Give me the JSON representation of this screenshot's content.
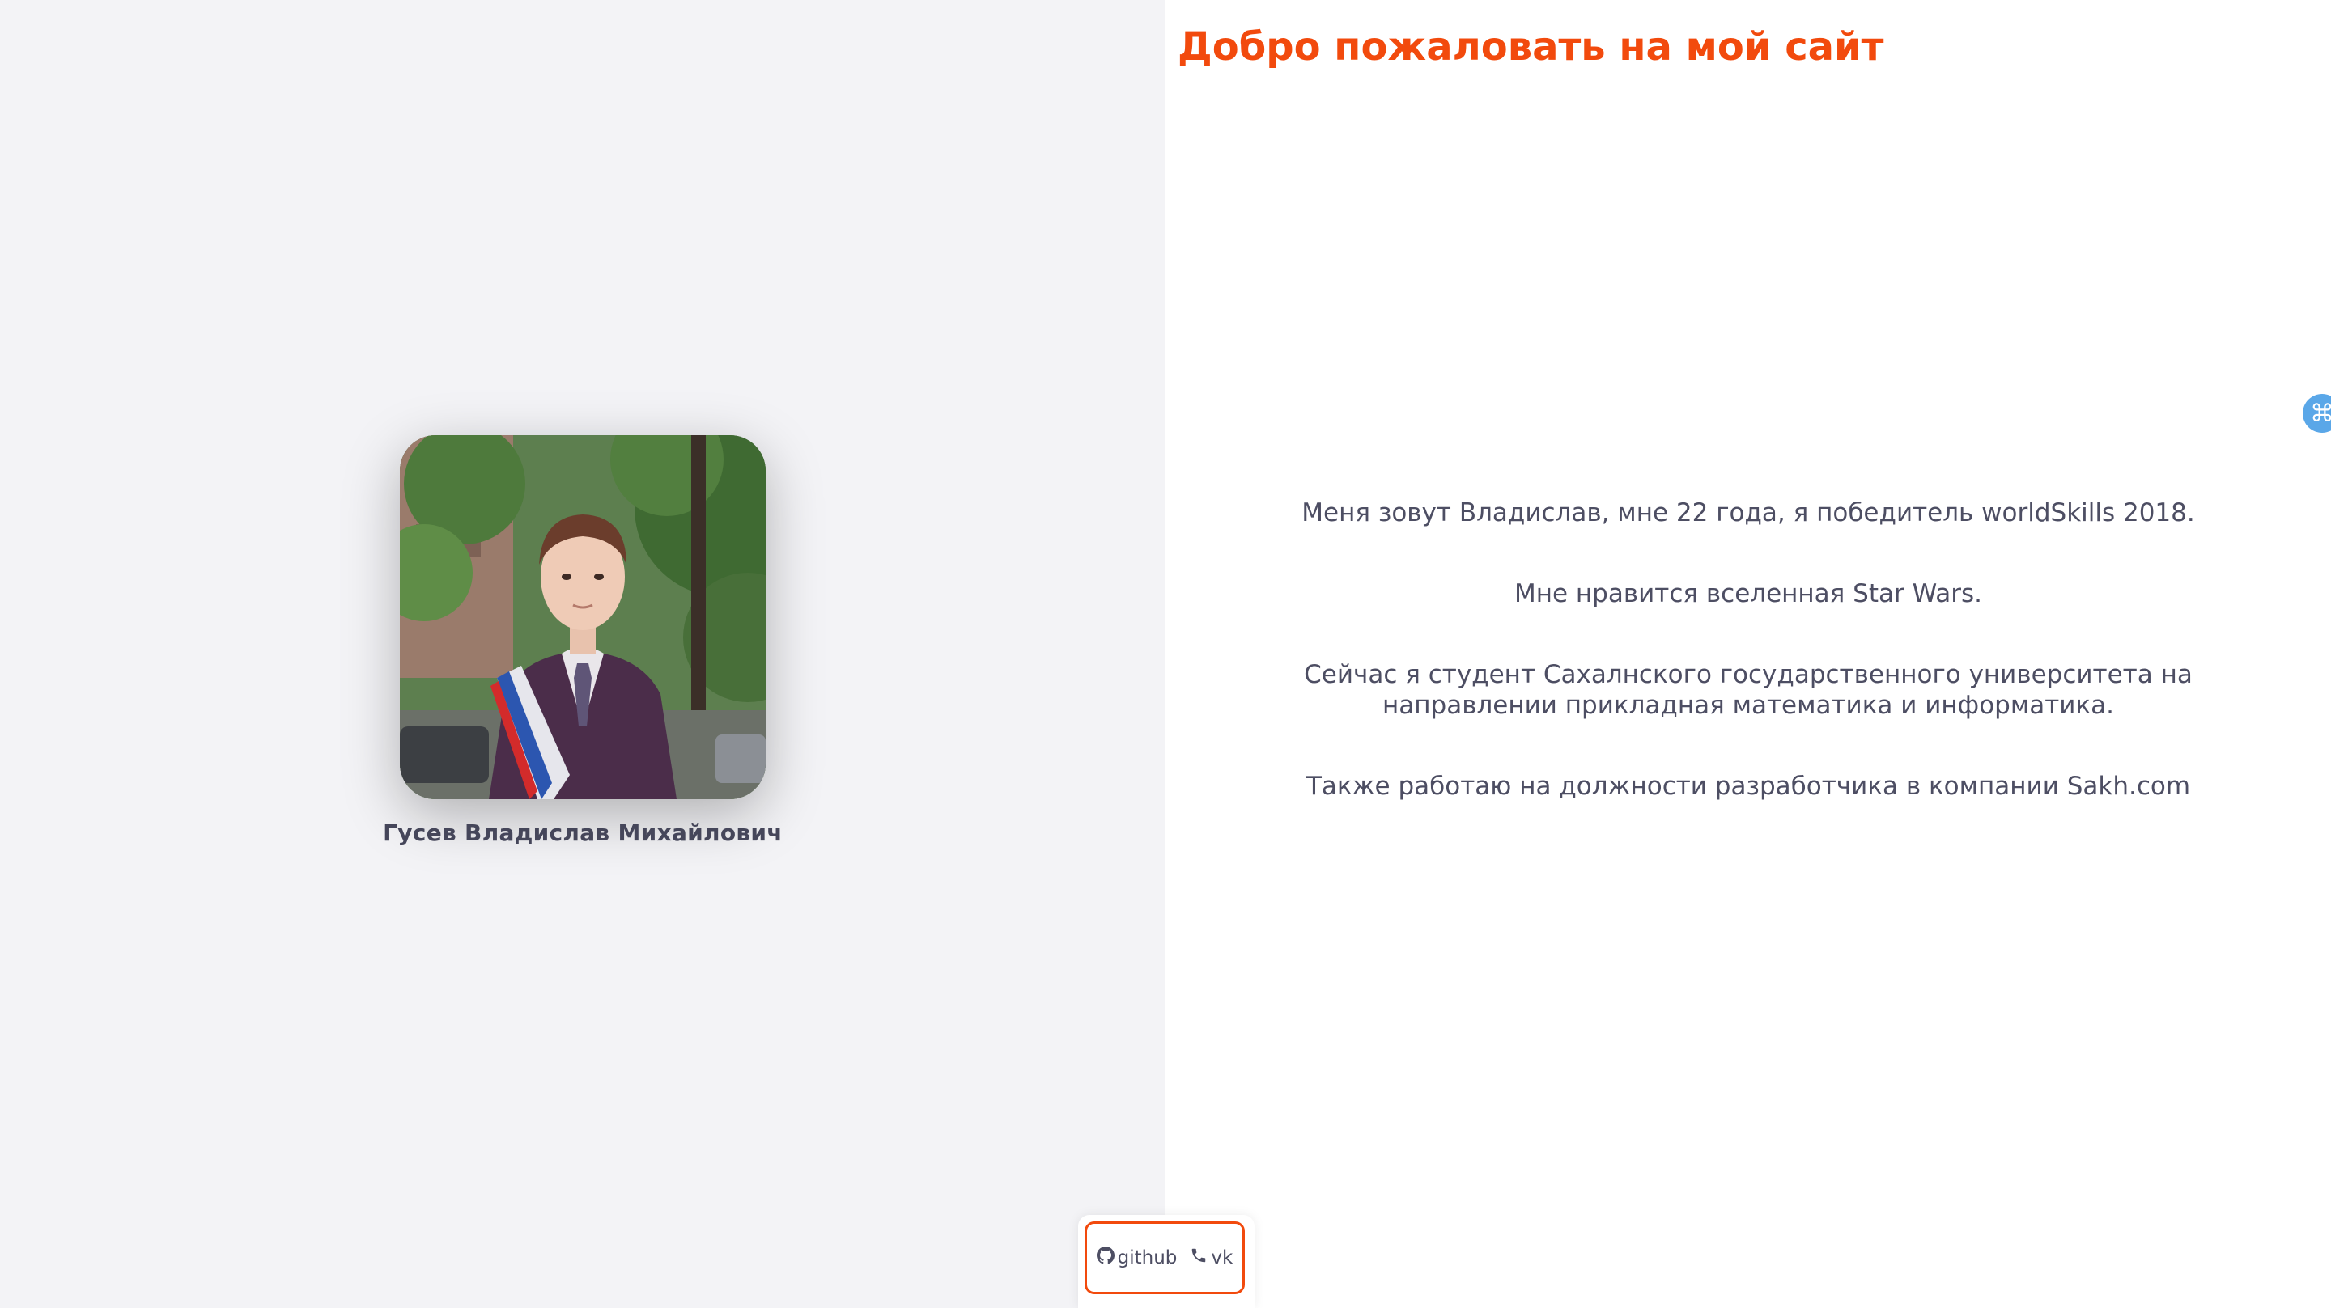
{
  "header": {
    "title": "Добро пожаловать на мой сайт"
  },
  "profile": {
    "name": "Гусев Владислав Михайлович",
    "photo_icon": "portrait-photo"
  },
  "about": {
    "paragraphs": [
      "Меня зовут Владислав, мне 22 года, я победитель worldSkills 2018.",
      "Мне нравится вселенная Star Wars.",
      "Сейчас я студент Сахалнского государственного университета на направлении прикладная математика и информатика.",
      "Также работаю на должности разработчика в компании Sakh.com"
    ]
  },
  "links": [
    {
      "label": "github",
      "icon": "github-icon"
    },
    {
      "label": "vk",
      "icon": "phone-icon"
    }
  ],
  "side_badge": {
    "glyph": "⌘",
    "icon": "command-icon"
  },
  "colors": {
    "accent": "#f24a0d",
    "text": "#4d4e63",
    "left_background": "#f3f3f6",
    "right_background": "#ffffff",
    "badge": "#5aa7e8"
  }
}
